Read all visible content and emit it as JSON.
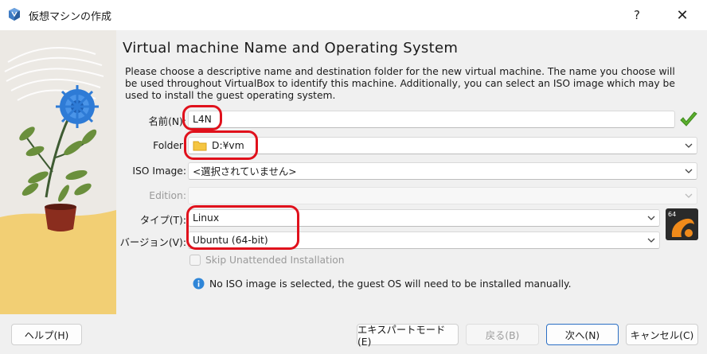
{
  "window": {
    "title": "仮想マシンの作成",
    "help_glyph": "?",
    "close_glyph": "✕"
  },
  "page": {
    "heading": "Virtual machine Name and Operating System",
    "description": "Please choose a descriptive name and destination folder for the new virtual machine. The name you choose will be used throughout VirtualBox to identify this machine. Additionally, you can select an ISO image which may be used to install the guest operating system."
  },
  "form": {
    "name_label": "名前(N):",
    "name_value": "L4N",
    "folder_label": "Folder:",
    "folder_value": "D:¥vm",
    "iso_label": "ISO Image:",
    "iso_value": "<選択されていません>",
    "edition_label": "Edition:",
    "edition_value": "",
    "type_label": "タイプ(T):",
    "type_value": "Linux",
    "version_label": "バージョン(V):",
    "version_value": "Ubuntu (64-bit)",
    "skip_label": "Skip Unattended Installation",
    "skip_checked": false,
    "info_text": "No ISO image is selected, the guest OS will need to be installed manually.",
    "os_logo_badge": "64"
  },
  "buttons": {
    "help": "ヘルプ(H)",
    "expert": "エキスパートモード(E)",
    "back": "戻る(B)",
    "next": "次へ(N)",
    "cancel": "キャンセル(C)"
  },
  "colors": {
    "highlight_ring": "#e0111c",
    "primary_border": "#2b6fc4",
    "valid_check": "#5aae2e"
  }
}
